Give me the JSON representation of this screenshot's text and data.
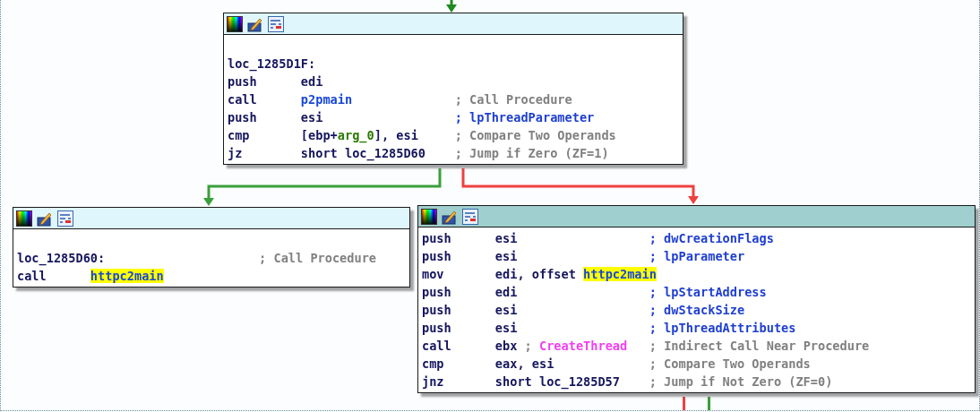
{
  "graph": {
    "blocks": [
      {
        "selected": false,
        "lines": [
          {
            "kind": "blank"
          },
          {
            "kind": "label",
            "text": "loc_1285D1F:"
          },
          {
            "kind": "insn",
            "mnemonic": "push",
            "operands": [
              {
                "kind": "plain",
                "text": "edi",
                "highlighted": false
              }
            ]
          },
          {
            "kind": "insn",
            "mnemonic": "call",
            "operands": [
              {
                "kind": "name",
                "text": "p2pmain",
                "highlighted": false
              }
            ],
            "comment": [
              {
                "kind": "comment",
                "text": "; Call Procedure"
              }
            ]
          },
          {
            "kind": "insn",
            "mnemonic": "push",
            "operands": [
              {
                "kind": "plain",
                "text": "esi",
                "highlighted": false
              }
            ],
            "comment": [
              {
                "kind": "ref",
                "text": "; lpThreadParameter"
              }
            ]
          },
          {
            "kind": "insn",
            "mnemonic": "cmp",
            "operands": [
              {
                "kind": "plain",
                "text": "[ebp+",
                "highlighted": false
              },
              {
                "kind": "var",
                "text": "arg_0",
                "highlighted": false,
                "joined": true
              },
              {
                "kind": "plain",
                "text": "],",
                "highlighted": false,
                "joined": true
              },
              {
                "kind": "plain",
                "text": "esi",
                "highlighted": false
              }
            ],
            "comment": [
              {
                "kind": "comment",
                "text": "; Compare Two Operands"
              }
            ]
          },
          {
            "kind": "insn",
            "mnemonic": "jz",
            "operands": [
              {
                "kind": "plain",
                "text": "short loc_1285D60",
                "highlighted": false
              }
            ],
            "comment": [
              {
                "kind": "comment",
                "text": "; Jump if Zero (ZF=1)"
              }
            ]
          }
        ]
      },
      {
        "selected": false,
        "lines": [
          {
            "kind": "blank"
          },
          {
            "kind": "label",
            "text": "loc_1285D60:",
            "comment": [
              {
                "kind": "comment",
                "text": "; Call Procedure"
              }
            ]
          },
          {
            "kind": "insn",
            "mnemonic": "call",
            "operands": [
              {
                "kind": "name",
                "text": "httpc2main",
                "highlighted": true
              }
            ]
          }
        ]
      },
      {
        "selected": true,
        "lines": [
          {
            "kind": "insn",
            "mnemonic": "push",
            "operands": [
              {
                "kind": "plain",
                "text": "esi",
                "highlighted": false
              }
            ],
            "comment": [
              {
                "kind": "ref",
                "text": "; dwCreationFlags"
              }
            ]
          },
          {
            "kind": "insn",
            "mnemonic": "push",
            "operands": [
              {
                "kind": "plain",
                "text": "esi",
                "highlighted": false
              }
            ],
            "comment": [
              {
                "kind": "ref",
                "text": "; lpParameter"
              }
            ]
          },
          {
            "kind": "insn",
            "mnemonic": "mov",
            "operands": [
              {
                "kind": "plain",
                "text": "edi, offset",
                "highlighted": false
              },
              {
                "kind": "name",
                "text": "httpc2main",
                "highlighted": true
              }
            ]
          },
          {
            "kind": "insn",
            "mnemonic": "push",
            "operands": [
              {
                "kind": "plain",
                "text": "edi",
                "highlighted": false
              }
            ],
            "comment": [
              {
                "kind": "ref",
                "text": "; lpStartAddress"
              }
            ]
          },
          {
            "kind": "insn",
            "mnemonic": "push",
            "operands": [
              {
                "kind": "plain",
                "text": "esi",
                "highlighted": false
              }
            ],
            "comment": [
              {
                "kind": "ref",
                "text": "; dwStackSize"
              }
            ]
          },
          {
            "kind": "insn",
            "mnemonic": "push",
            "operands": [
              {
                "kind": "plain",
                "text": "esi",
                "highlighted": false
              }
            ],
            "comment": [
              {
                "kind": "ref",
                "text": "; lpThreadAttributes"
              }
            ]
          },
          {
            "kind": "insn",
            "mnemonic": "call",
            "operands": [
              {
                "kind": "plain",
                "text": "ebx",
                "highlighted": false
              },
              {
                "kind": "comment",
                "text": ";",
                "highlighted": false
              },
              {
                "kind": "api",
                "text": "CreateThread",
                "highlighted": false
              }
            ],
            "comment": [
              {
                "kind": "comment",
                "text": "; Indirect Call Near Procedure"
              }
            ]
          },
          {
            "kind": "insn",
            "mnemonic": "cmp",
            "operands": [
              {
                "kind": "plain",
                "text": "eax, esi",
                "highlighted": false
              }
            ],
            "comment": [
              {
                "kind": "comment",
                "text": "; Compare Two Operands"
              }
            ]
          },
          {
            "kind": "insn",
            "mnemonic": "jnz",
            "operands": [
              {
                "kind": "plain",
                "text": "short loc_1285D57",
                "highlighted": false
              }
            ],
            "comment": [
              {
                "kind": "comment",
                "text": "; Jump if Not Zero (ZF=0)"
              }
            ]
          }
        ]
      }
    ],
    "edges": [
      {
        "color": "#1f8a1f"
      },
      {
        "color": "#3aa03a"
      },
      {
        "color": "#f04040"
      },
      {
        "color": "#f04040"
      },
      {
        "color": "#3aa03a"
      }
    ]
  }
}
